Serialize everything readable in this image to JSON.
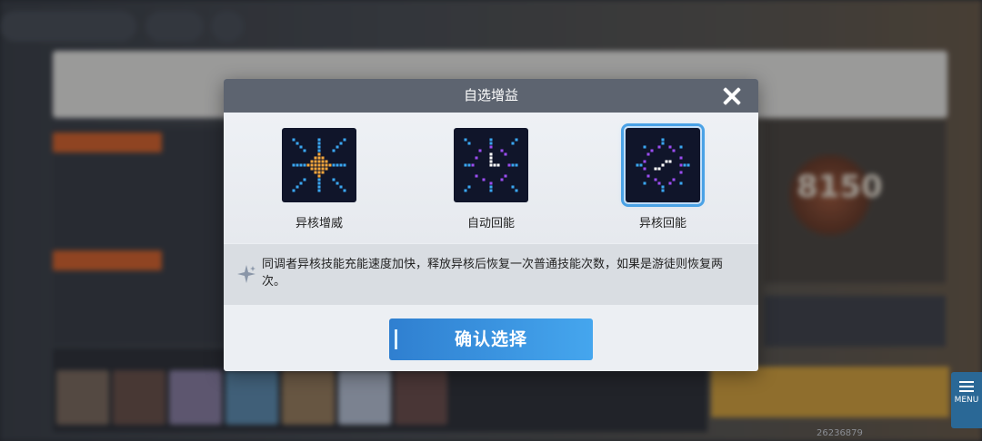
{
  "dialog": {
    "title": "自选增益",
    "options": [
      {
        "label": "异核增威",
        "icon": "gold-gear-snowflake-icon",
        "selected": false
      },
      {
        "label": "自动回能",
        "icon": "clock-gear-icon",
        "selected": false
      },
      {
        "label": "异核回能",
        "icon": "gauge-gear-icon",
        "selected": true
      }
    ],
    "description": "同调者异核技能充能速度加快，释放异核后恢复一次普通技能次数，如果是游徒则恢复两次。",
    "confirm_label": "确认选择"
  },
  "background": {
    "score": "8150",
    "menu_label": "MENU",
    "uid": "26236879"
  },
  "colors": {
    "accent_blue": "#3a92de",
    "header_gray": "#5d6470",
    "tile_dark": "#10152a",
    "pixel_gold": "#f3a63c",
    "pixel_blue": "#3aa6f0",
    "pixel_purple": "#9a4cf0"
  }
}
